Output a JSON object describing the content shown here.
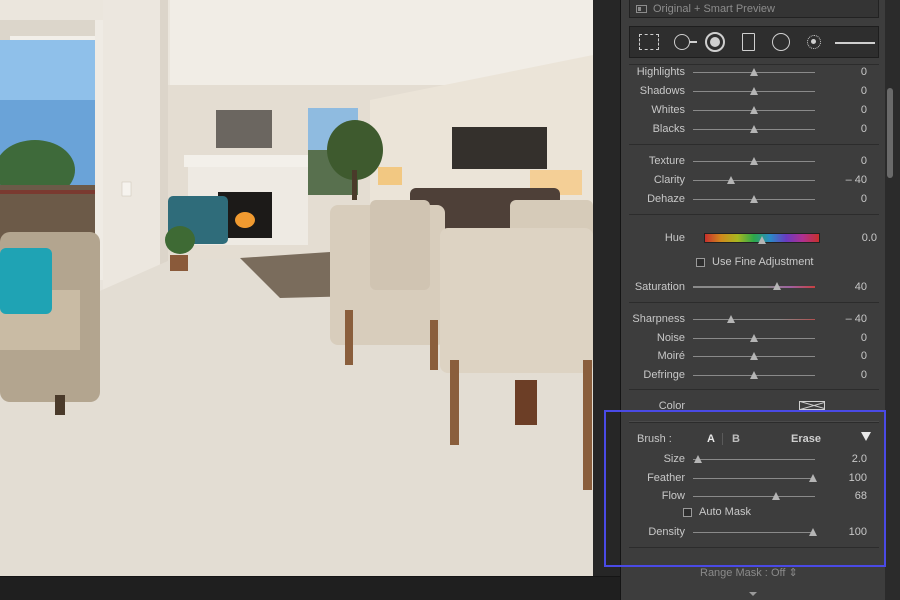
{
  "preview": {
    "label": "Original + Smart Preview"
  },
  "toolstrip": {
    "tools": [
      "crop-overlay",
      "spot-removal",
      "red-eye-correction",
      "graduated-filter",
      "radial-filter",
      "adjustment-brush"
    ]
  },
  "sliders": {
    "highlights": {
      "label": "Highlights",
      "value": "0",
      "position": 0.5
    },
    "shadows": {
      "label": "Shadows",
      "value": "0",
      "position": 0.5
    },
    "whites": {
      "label": "Whites",
      "value": "0",
      "position": 0.5
    },
    "blacks": {
      "label": "Blacks",
      "value": "0",
      "position": 0.5
    },
    "texture": {
      "label": "Texture",
      "value": "0",
      "position": 0.5
    },
    "clarity": {
      "label": "Clarity",
      "value": "– 40",
      "position": 0.31
    },
    "dehaze": {
      "label": "Dehaze",
      "value": "0",
      "position": 0.5
    },
    "hue": {
      "label": "Hue",
      "value": "0.0",
      "position": 0.5
    },
    "saturation": {
      "label": "Saturation",
      "value": "40",
      "position": 0.69
    },
    "sharpness": {
      "label": "Sharpness",
      "value": "– 40",
      "position": 0.31
    },
    "noise": {
      "label": "Noise",
      "value": "0",
      "position": 0.5
    },
    "moire": {
      "label": "Moiré",
      "value": "0",
      "position": 0.5
    },
    "defringe": {
      "label": "Defringe",
      "value": "0",
      "position": 0.5
    }
  },
  "fine_adjustment": {
    "label": "Use Fine Adjustment",
    "checked": false
  },
  "color": {
    "label": "Color"
  },
  "brush": {
    "label": "Brush :",
    "a": "A",
    "b": "B",
    "erase": "Erase",
    "size": {
      "label": "Size",
      "value": "2.0",
      "position": 0.04
    },
    "feather": {
      "label": "Feather",
      "value": "100",
      "position": 0.98
    },
    "flow": {
      "label": "Flow",
      "value": "68",
      "position": 0.68
    },
    "auto_mask": {
      "label": "Auto Mask",
      "checked": false
    },
    "density": {
      "label": "Density",
      "value": "100",
      "position": 0.98
    }
  },
  "range_mask": {
    "label": "Range Mask :",
    "value": "Off"
  },
  "colors": {
    "highlight_box": "#4a4ae6",
    "panel_bg": "#3d3d3d"
  }
}
